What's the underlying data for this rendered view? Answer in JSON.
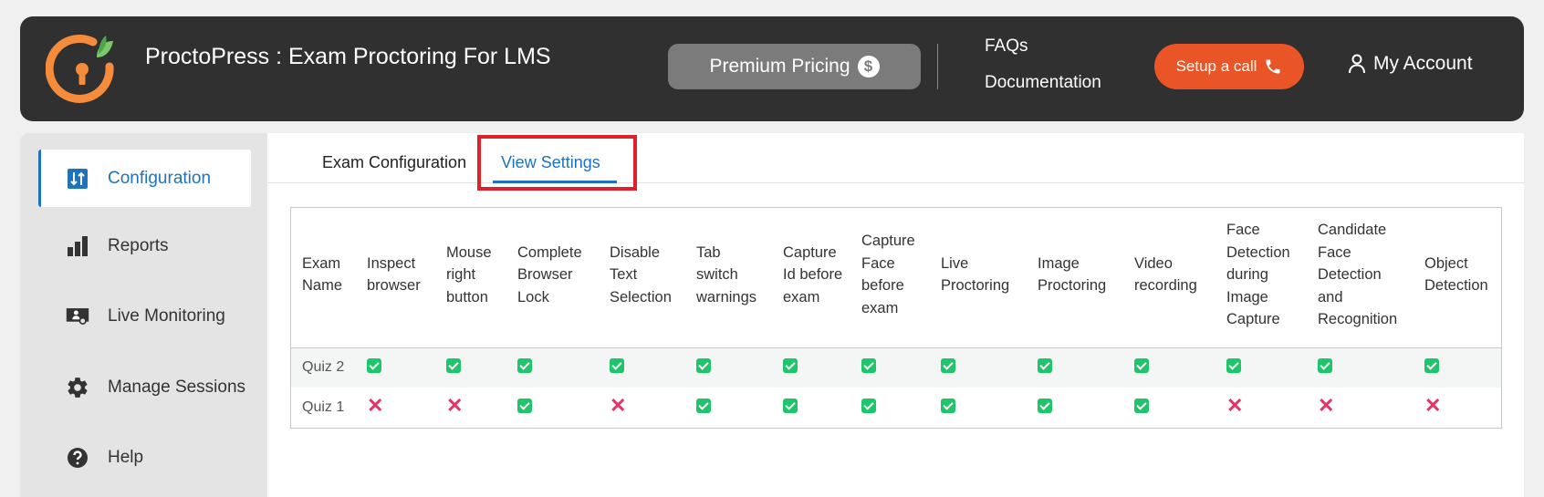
{
  "header": {
    "title": "ProctoPress : Exam Proctoring For LMS",
    "premium_label": "Premium Pricing",
    "premium_icon": "dollar-icon",
    "faqs_label": "FAQs",
    "docs_label": "Documentation",
    "call_label": "Setup a call",
    "call_icon": "phone-icon",
    "account_label": "My Account",
    "account_icon": "user-icon",
    "colors": {
      "bg": "#303030",
      "call": "#ea5527",
      "premium": "#7b7b7b",
      "logo_ring": "#f58c3c",
      "logo_leaf": "#5fba5a"
    }
  },
  "sidebar": {
    "items": [
      {
        "label": "Configuration",
        "icon": "sliders-icon",
        "active": true
      },
      {
        "label": "Reports",
        "icon": "bar-chart-icon",
        "active": false
      },
      {
        "label": "Live Monitoring",
        "icon": "monitor-user-icon",
        "active": false
      },
      {
        "label": "Manage Sessions",
        "icon": "gear-icon",
        "active": false
      },
      {
        "label": "Help",
        "icon": "question-circle-icon",
        "active": false
      }
    ]
  },
  "tabs": [
    {
      "label": "Exam Configuration",
      "active": false
    },
    {
      "label": "View Settings",
      "active": true
    }
  ],
  "table": {
    "columns": [
      "Exam Name",
      "Inspect browser",
      "Mouse right button",
      "Complete Browser Lock",
      "Disable Text Selection",
      "Tab switch warnings",
      "Capture Id before exam",
      "Capture Face before exam",
      "Live Proctoring",
      "Image Proctoring",
      "Video recording",
      "Face Detection during Image Capture",
      "Candidate Face Detection and Recognition",
      "Object Detection"
    ],
    "rows": [
      {
        "name": "Quiz 2",
        "values": [
          true,
          true,
          true,
          true,
          true,
          true,
          true,
          true,
          true,
          true,
          true,
          true,
          true
        ]
      },
      {
        "name": "Quiz 1",
        "values": [
          false,
          false,
          true,
          false,
          true,
          true,
          true,
          true,
          true,
          true,
          false,
          false,
          false
        ]
      }
    ],
    "colors": {
      "enabled": "#1ec56a",
      "disabled": "#e63264"
    }
  }
}
